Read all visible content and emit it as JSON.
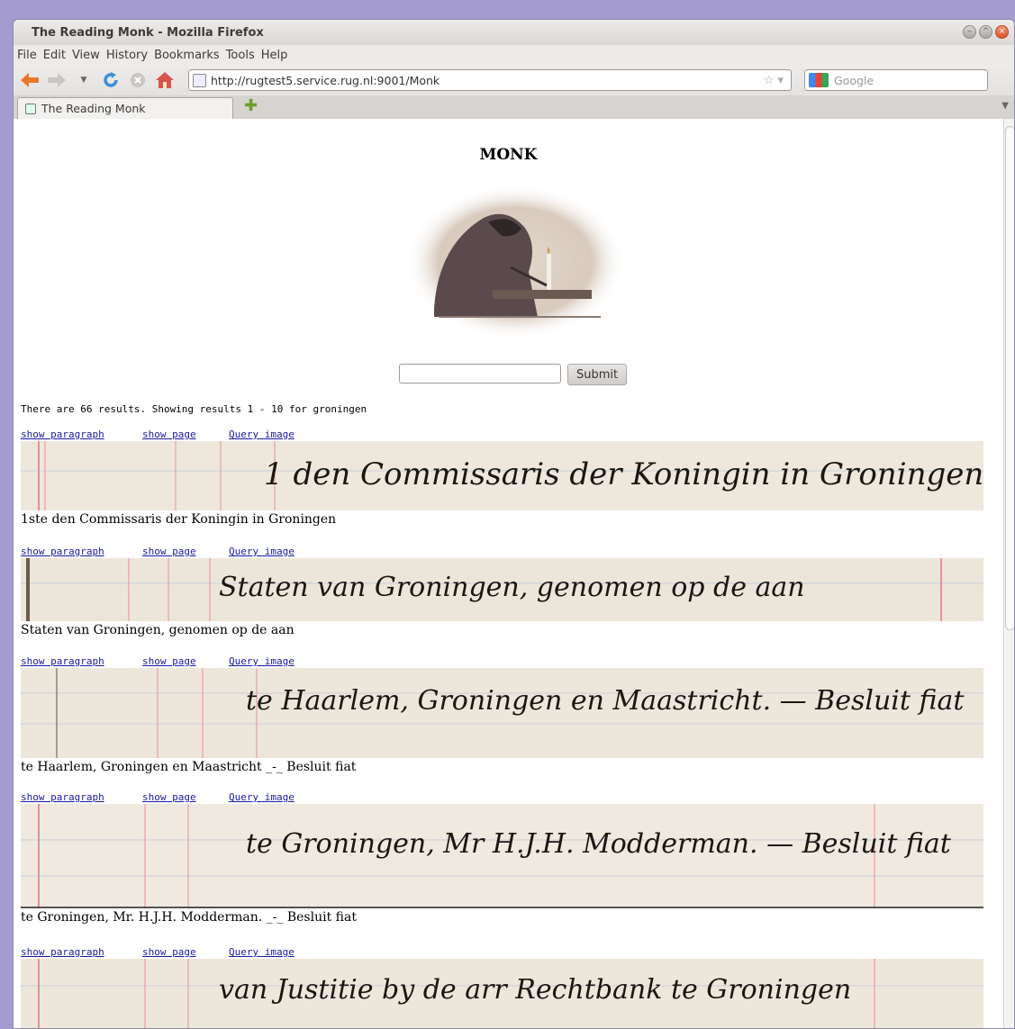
{
  "window": {
    "title": "The Reading Monk - Mozilla Firefox",
    "menu": [
      "File",
      "Edit",
      "View",
      "History",
      "Bookmarks",
      "Tools",
      "Help"
    ]
  },
  "toolbar": {
    "url": "http://rugtest5.service.rug.nl:9001/Monk",
    "search_placeholder": "Google"
  },
  "tabs": [
    {
      "label": "The Reading Monk"
    }
  ],
  "page": {
    "title": "MONK",
    "submit_label": "Submit",
    "results_summary": "There are 66 results. Showing results 1 - 10 for groningen",
    "link_labels": {
      "paragraph": "show paragraph",
      "page": "show page",
      "image": "Query image"
    },
    "results": [
      {
        "transcription": "1ste den Commissaris der Koningin in Groningen",
        "script": "1 den Commissaris der Koningin in Groningen"
      },
      {
        "transcription": "Staten van Groningen, genomen op de aan",
        "script": "Staten van Groningen, genomen op de aan"
      },
      {
        "transcription": "te Haarlem, Groningen en Maastricht _-_ Besluit fiat",
        "script": "te Haarlem, Groningen en Maastricht. — Besluit fiat"
      },
      {
        "transcription": "te Groningen, Mr. H.J.H. Modderman. _-_ Besluit fiat",
        "script": "te Groningen, Mr H.J.H. Modderman. — Besluit fiat"
      },
      {
        "transcription": "",
        "script": "van Justitie by de arr Rechtbank te Groningen"
      }
    ]
  },
  "colors": {
    "desktop": "#a49bcf",
    "link": "#1a1aa6",
    "paper": "#eee7dc",
    "ink": "#1a1612",
    "margin_line": "#e8909a"
  }
}
